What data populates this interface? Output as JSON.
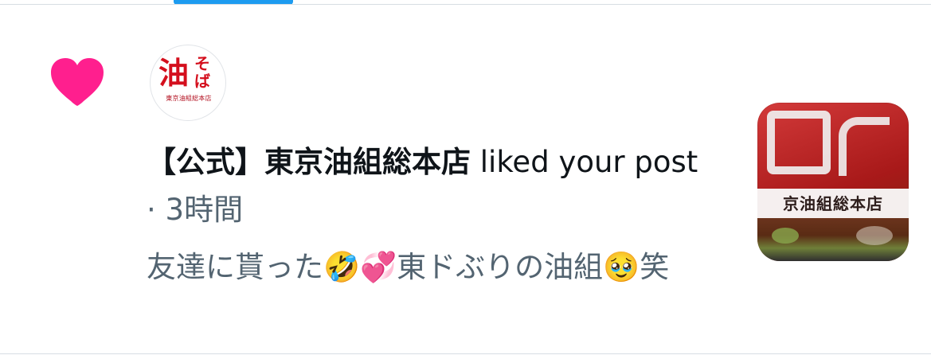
{
  "colors": {
    "heart": "#ff1f8e",
    "accent": "#1d9bf0",
    "primary_text": "#0f1419",
    "secondary_text": "#536471",
    "divider": "#d7dde3"
  },
  "notification": {
    "icon": "heart-icon",
    "avatar": {
      "main_text": "油",
      "side_text": "そば",
      "small_text": "東京油組総本店"
    },
    "account_name": "【公式】東京油組総本店",
    "action_text": "liked your post",
    "separator": "·",
    "time_ago": "3時間",
    "tweet_text": "友達に貰った🤣💞東ドぶりの油組🥹笑",
    "thumbnail": {
      "label": "京油組総本店"
    }
  }
}
